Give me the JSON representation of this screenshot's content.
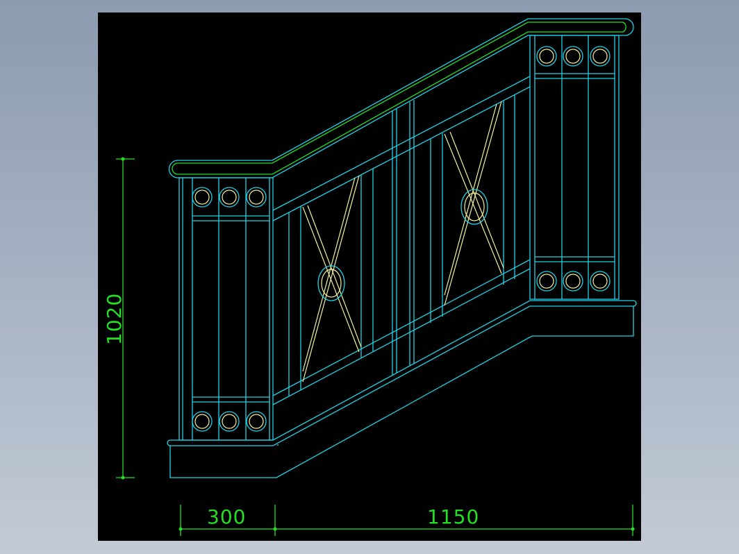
{
  "drawing": {
    "dimensions": {
      "height": "1020",
      "left_width": "300",
      "right_width": "1150"
    },
    "colors": {
      "background": "#000000",
      "outline": "#22d3e6",
      "dimension": "#24e024",
      "baluster": "#f2f2a0",
      "frame": "#a9b4c4"
    }
  }
}
